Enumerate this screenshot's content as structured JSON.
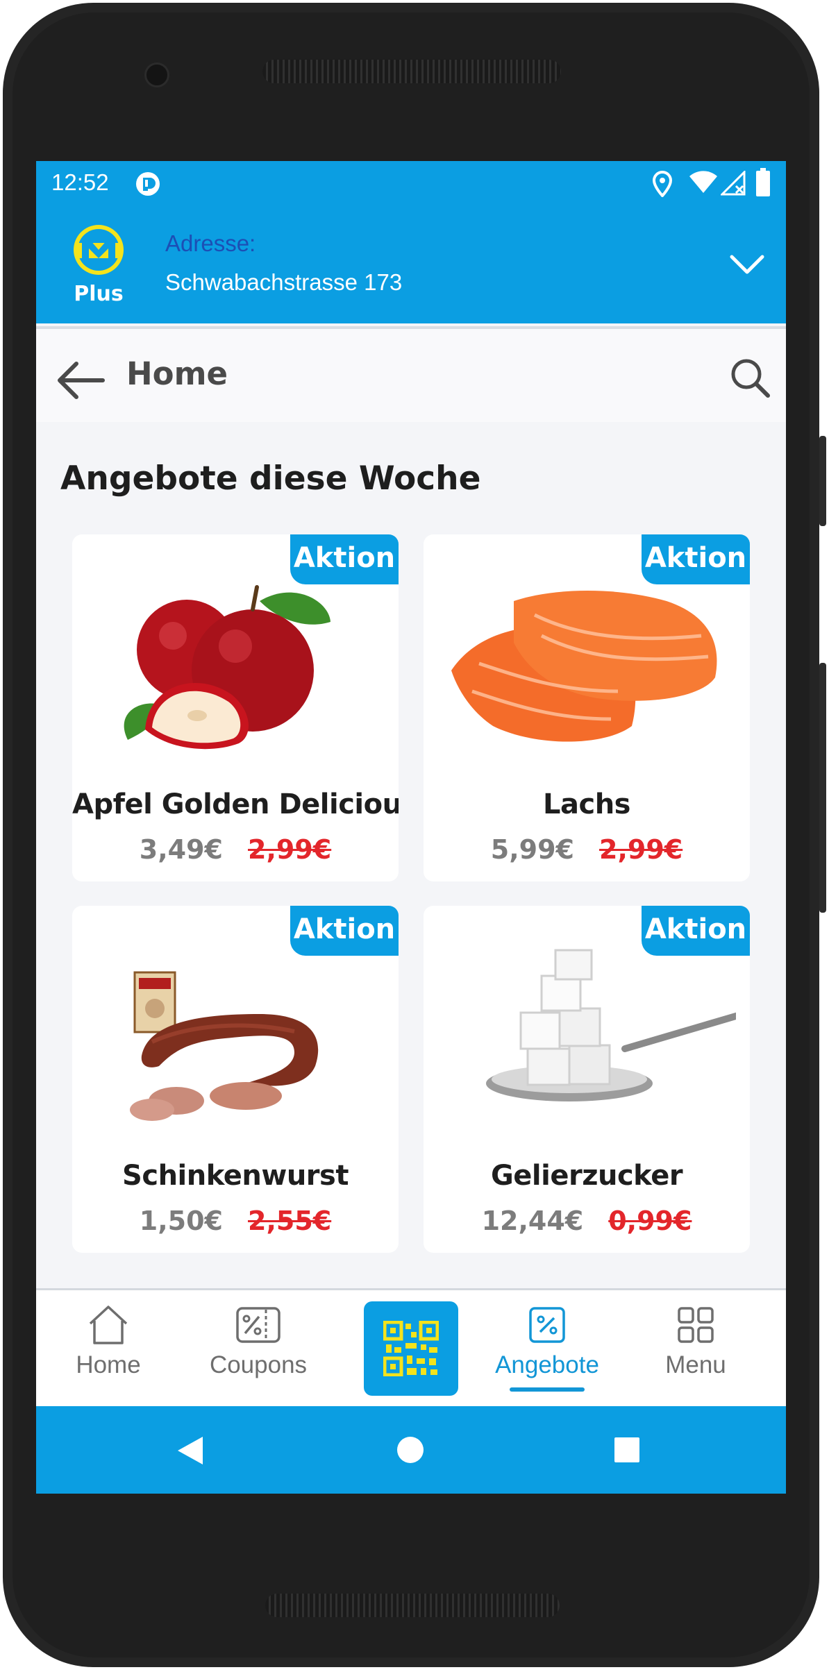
{
  "status_bar": {
    "time": "12:52",
    "icons": [
      "app-notification-icon",
      "location-icon",
      "wifi-icon",
      "signal-icon",
      "battery-icon"
    ]
  },
  "header": {
    "logo_text": "Plus",
    "address_label": "Adresse:",
    "address_value": "Schwabachstrasse 173"
  },
  "nav": {
    "title": "Home"
  },
  "section": {
    "title": "Angebote diese Woche"
  },
  "products": [
    {
      "name": "Apfel Golden Delicious",
      "badge": "Aktion",
      "old_price": "3,49€",
      "new_price": "2,99€"
    },
    {
      "name": "Lachs",
      "badge": "Aktion",
      "old_price": "5,99€",
      "new_price": "2,99€"
    },
    {
      "name": "Schinkenwurst",
      "badge": "Aktion",
      "old_price": "1,50€",
      "new_price": "2,55€"
    },
    {
      "name": "Gelierzucker",
      "badge": "Aktion",
      "old_price": "12,44€",
      "new_price": "0,99€"
    }
  ],
  "bottom_nav": {
    "items": [
      {
        "label": "Home"
      },
      {
        "label": "Coupons"
      },
      {
        "label": "Angebote"
      },
      {
        "label": "Menu"
      }
    ],
    "active": "Angebote"
  },
  "colors": {
    "brand_blue": "#0b9ee2",
    "price_red": "#e3262b",
    "logo_yellow": "#f4e31c"
  }
}
